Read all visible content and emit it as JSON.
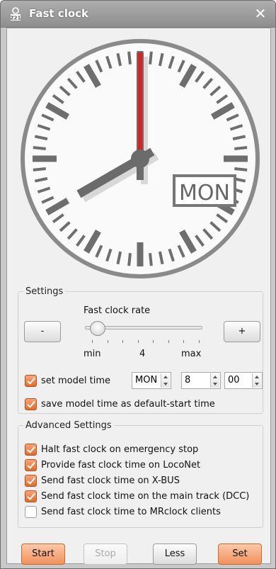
{
  "window": {
    "title": "Fast clock",
    "close_glyph": "✕",
    "icon": "app-icon-z21"
  },
  "clock": {
    "hour": 8,
    "minute": 0,
    "weekday": "MON"
  },
  "settings": {
    "legend": "Settings",
    "rate_label": "Fast clock rate",
    "minus_label": "-",
    "plus_label": "+",
    "rate_min_label": "min",
    "rate_value_label": "4",
    "rate_max_label": "max",
    "rate_position": 0.05,
    "set_model_time": {
      "checked": true,
      "label": "set model time"
    },
    "day_value": "MON",
    "hour_value": "8",
    "minute_value": "00",
    "save_default": {
      "checked": true,
      "label": "save model time as default-start time"
    }
  },
  "advanced": {
    "legend": "Advanced Settings",
    "options": [
      {
        "label": "Halt fast clock on emergency stop",
        "checked": true
      },
      {
        "label": "Provide fast clock time on LocoNet",
        "checked": true
      },
      {
        "label": "Send fast clock time on X-BUS",
        "checked": true
      },
      {
        "label": "Send fast clock time on the main track (DCC)",
        "checked": true
      },
      {
        "label": "Send fast clock time to MRclock clients",
        "checked": false
      }
    ]
  },
  "buttons": {
    "start": "Start",
    "stop": "Stop",
    "less": "Less",
    "set": "Set"
  },
  "colors": {
    "accent": "#f1915c",
    "second_hand": "#e02020",
    "hands": "#6b6b6b"
  }
}
